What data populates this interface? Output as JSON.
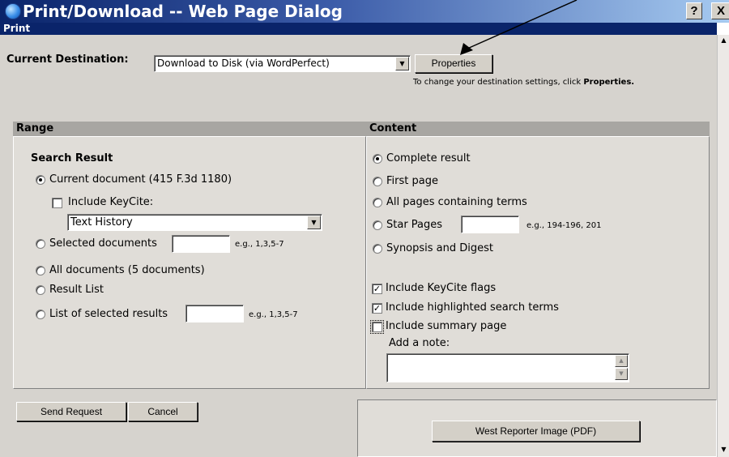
{
  "window": {
    "title": "Print/Download -- Web Page Dialog",
    "help_label": "?",
    "close_label": "X"
  },
  "section_label": "Print",
  "destination": {
    "label": "Current Destination:",
    "value": "Download to Disk (via WordPerfect)",
    "properties_button": "Properties",
    "hint_prefix": "To change your destination settings, click ",
    "hint_bold": "Properties."
  },
  "range": {
    "header": "Range",
    "subheading": "Search Result",
    "current_document": "Current document (415 F.3d 1180)",
    "include_keycite": "Include KeyCite:",
    "keycite_select": "Text History",
    "selected_documents": "Selected documents",
    "selected_documents_example": "e.g., 1,3,5-7",
    "all_documents": "All documents (5 documents)",
    "result_list": "Result List",
    "list_selected_results": "List of selected results",
    "list_selected_example": "e.g., 1,3,5-7"
  },
  "content": {
    "header": "Content",
    "complete_result": "Complete result",
    "first_page": "First page",
    "all_pages_terms": "All pages containing terms",
    "star_pages": "Star Pages",
    "star_pages_example": "e.g., 194-196, 201",
    "synopsis_digest": "Synopsis and Digest",
    "include_keycite_flags": "Include KeyCite flags",
    "include_highlighted": "Include highlighted search terms",
    "include_summary": "Include summary page",
    "add_note": "Add a note:"
  },
  "buttons": {
    "send_request": "Send Request",
    "cancel": "Cancel",
    "west_reporter": "West Reporter Image (PDF)"
  },
  "selected_radio_range": "current_document",
  "selected_radio_content": "complete_result",
  "checked": {
    "include_keycite": false,
    "include_keycite_flags": true,
    "include_highlighted": true,
    "include_summary": false
  },
  "colors": {
    "title_bar_dark": "#0a246a",
    "title_bar_light": "#a6caf0",
    "dialog_face": "#d6d3ce",
    "section_header": "#a8a6a2"
  },
  "icons": {
    "app": "ie-globe-icon",
    "dropdown": "chevron-down-icon"
  }
}
